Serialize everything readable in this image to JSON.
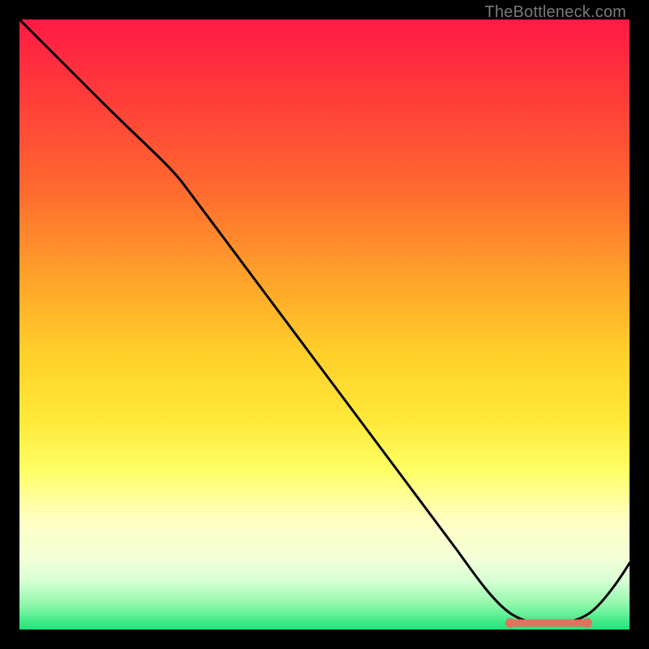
{
  "attribution": "TheBottleneck.com",
  "chart_data": {
    "type": "line",
    "title": "",
    "xlabel": "",
    "ylabel": "",
    "xlim": [
      0,
      100
    ],
    "ylim": [
      0,
      100
    ],
    "x": [
      0,
      12,
      25,
      40,
      55,
      70,
      78,
      82,
      86,
      90,
      94,
      100
    ],
    "values": [
      100,
      90,
      80,
      60,
      40,
      20,
      8,
      2,
      0,
      0,
      2,
      10
    ],
    "optimal_band": {
      "x_start": 82,
      "x_end": 94,
      "y": 1
    },
    "gradient_stops": [
      {
        "pos": 0,
        "color": "#ff1a44"
      },
      {
        "pos": 50,
        "color": "#ffd02a"
      },
      {
        "pos": 80,
        "color": "#ffffc2"
      },
      {
        "pos": 100,
        "color": "#1de47a"
      }
    ]
  }
}
